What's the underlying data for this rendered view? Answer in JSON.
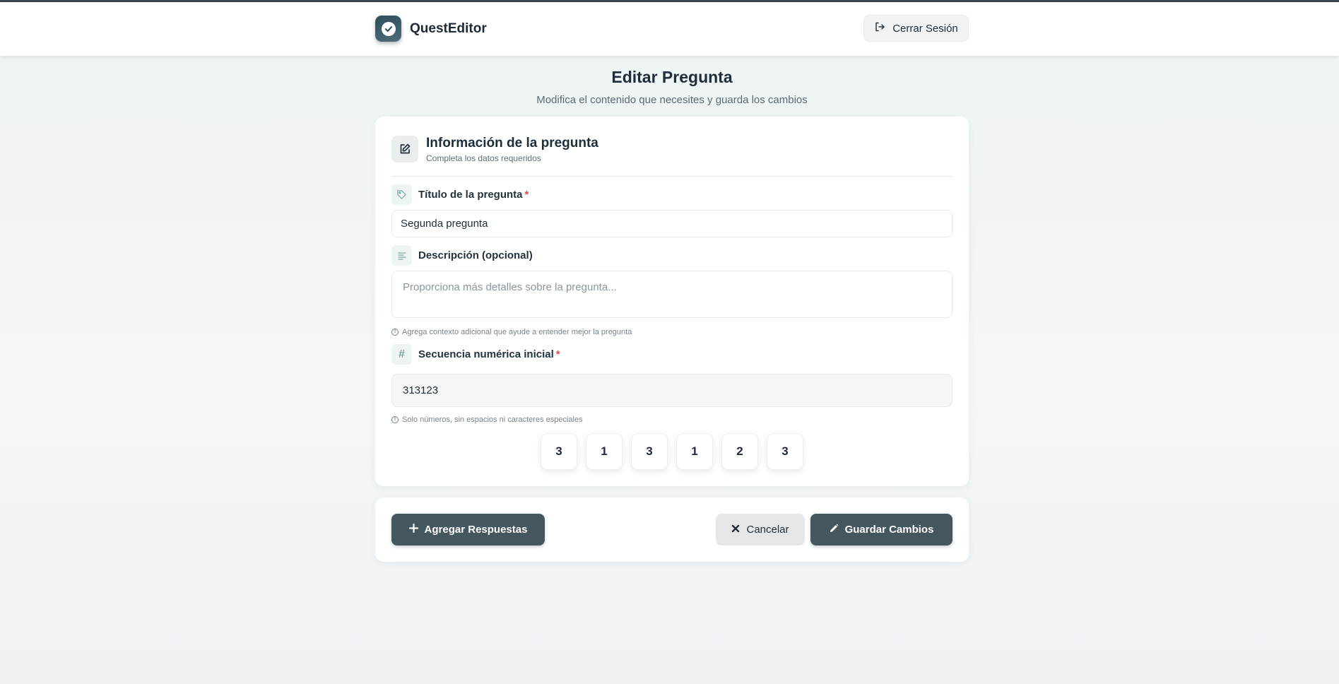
{
  "app": {
    "name": "QuestEditor",
    "logout_label": "Cerrar Sesión"
  },
  "page": {
    "title": "Editar Pregunta",
    "subtitle": "Modifica el contenido que necesites y guarda los cambios"
  },
  "form": {
    "section_title": "Información de la pregunta",
    "section_subtitle": "Completa los datos requeridos",
    "title_field": {
      "label": "Título de la pregunta",
      "required_mark": "*",
      "value": "Segunda pregunta"
    },
    "description_field": {
      "label": "Descripción (opcional)",
      "placeholder": "Proporciona más detalles sobre la pregunta...",
      "value": "",
      "hint": "Agrega contexto adicional que ayude a entender mejor la pregunta"
    },
    "sequence_field": {
      "label": "Secuencia numérica inicial",
      "required_mark": "*",
      "value": "313123",
      "hint": "Solo números, sin espacios ni caracteres especiales"
    },
    "digits": [
      "3",
      "1",
      "3",
      "1",
      "2",
      "3"
    ]
  },
  "actions": {
    "add_answers_label": "Agregar Respuestas",
    "cancel_label": "Cancelar",
    "save_label": "Guardar Cambios"
  },
  "icons": {
    "logo": "check-circle-icon",
    "logout": "sign-out-icon",
    "section": "edit-icon",
    "title_field": "tag-icon",
    "description_field": "align-left-icon",
    "sequence_field": "hash-icon",
    "hint": "info-circle-icon",
    "add": "plus-icon",
    "cancel": "x-icon",
    "save": "pencil-icon"
  },
  "colors": {
    "primary_button": "#44575f",
    "required": "#e04a4a",
    "accent_icon": "#7aa7a7"
  }
}
